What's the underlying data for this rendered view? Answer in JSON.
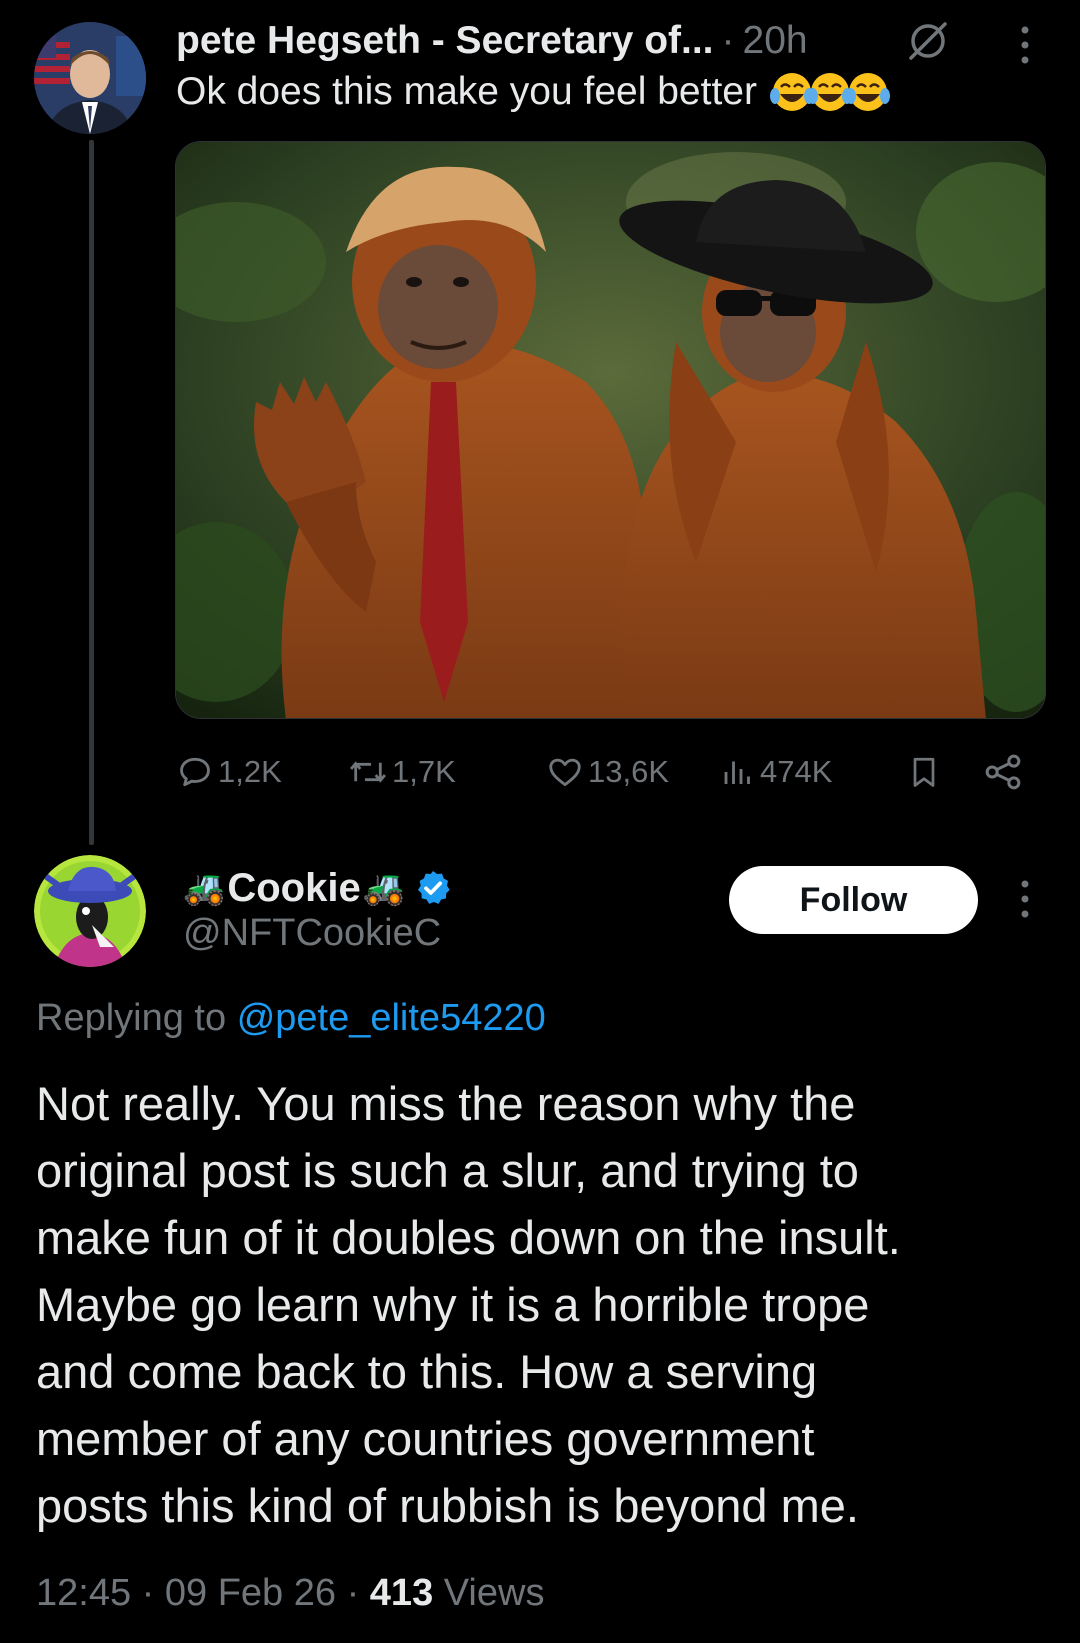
{
  "tweet": {
    "author_name": "pete Hegseth - Secretary of...",
    "separator": "·",
    "time": "20h",
    "text": "Ok does this make you feel better",
    "emojis": [
      "face-with-tears-of-joy",
      "face-with-tears-of-joy",
      "face-with-tears-of-joy"
    ],
    "image_alt": "two orangutans in a jungle, one with a blond wig and red tie, one with a wide black hat and sunglasses",
    "stats": {
      "replies": "1,2K",
      "reposts": "1,7K",
      "likes": "13,6K",
      "views": "474K"
    },
    "icons": [
      "reply-icon",
      "repost-icon",
      "like-icon",
      "views-icon",
      "bookmark-icon",
      "share-icon",
      "grok-icon",
      "more-icon"
    ]
  },
  "reply": {
    "display_name": "Cookie",
    "name_emoji": "tractor",
    "handle": "@NFTCookieC",
    "verified": true,
    "follow_label": "Follow",
    "replying_prefix": "Replying to",
    "replying_mention": "@pete_elite54220",
    "body_lines": [
      "Not really.   You miss the reason why the",
      "original post is such a slur, and trying to",
      "make fun of it doubles down on the insult.",
      "Maybe go learn why it is a horrible trope",
      "and come back to this.  How a serving",
      "member of any countries government",
      "posts this kind of rubbish is beyond me."
    ],
    "time": "12:45",
    "date": "09 Feb 26",
    "views_count": "413",
    "views_label": "Views"
  },
  "colors": {
    "background": "#000000",
    "text": "#e7e9ea",
    "muted": "#71767b",
    "link": "#1d9bf0",
    "verified": "#1d9bf0"
  }
}
